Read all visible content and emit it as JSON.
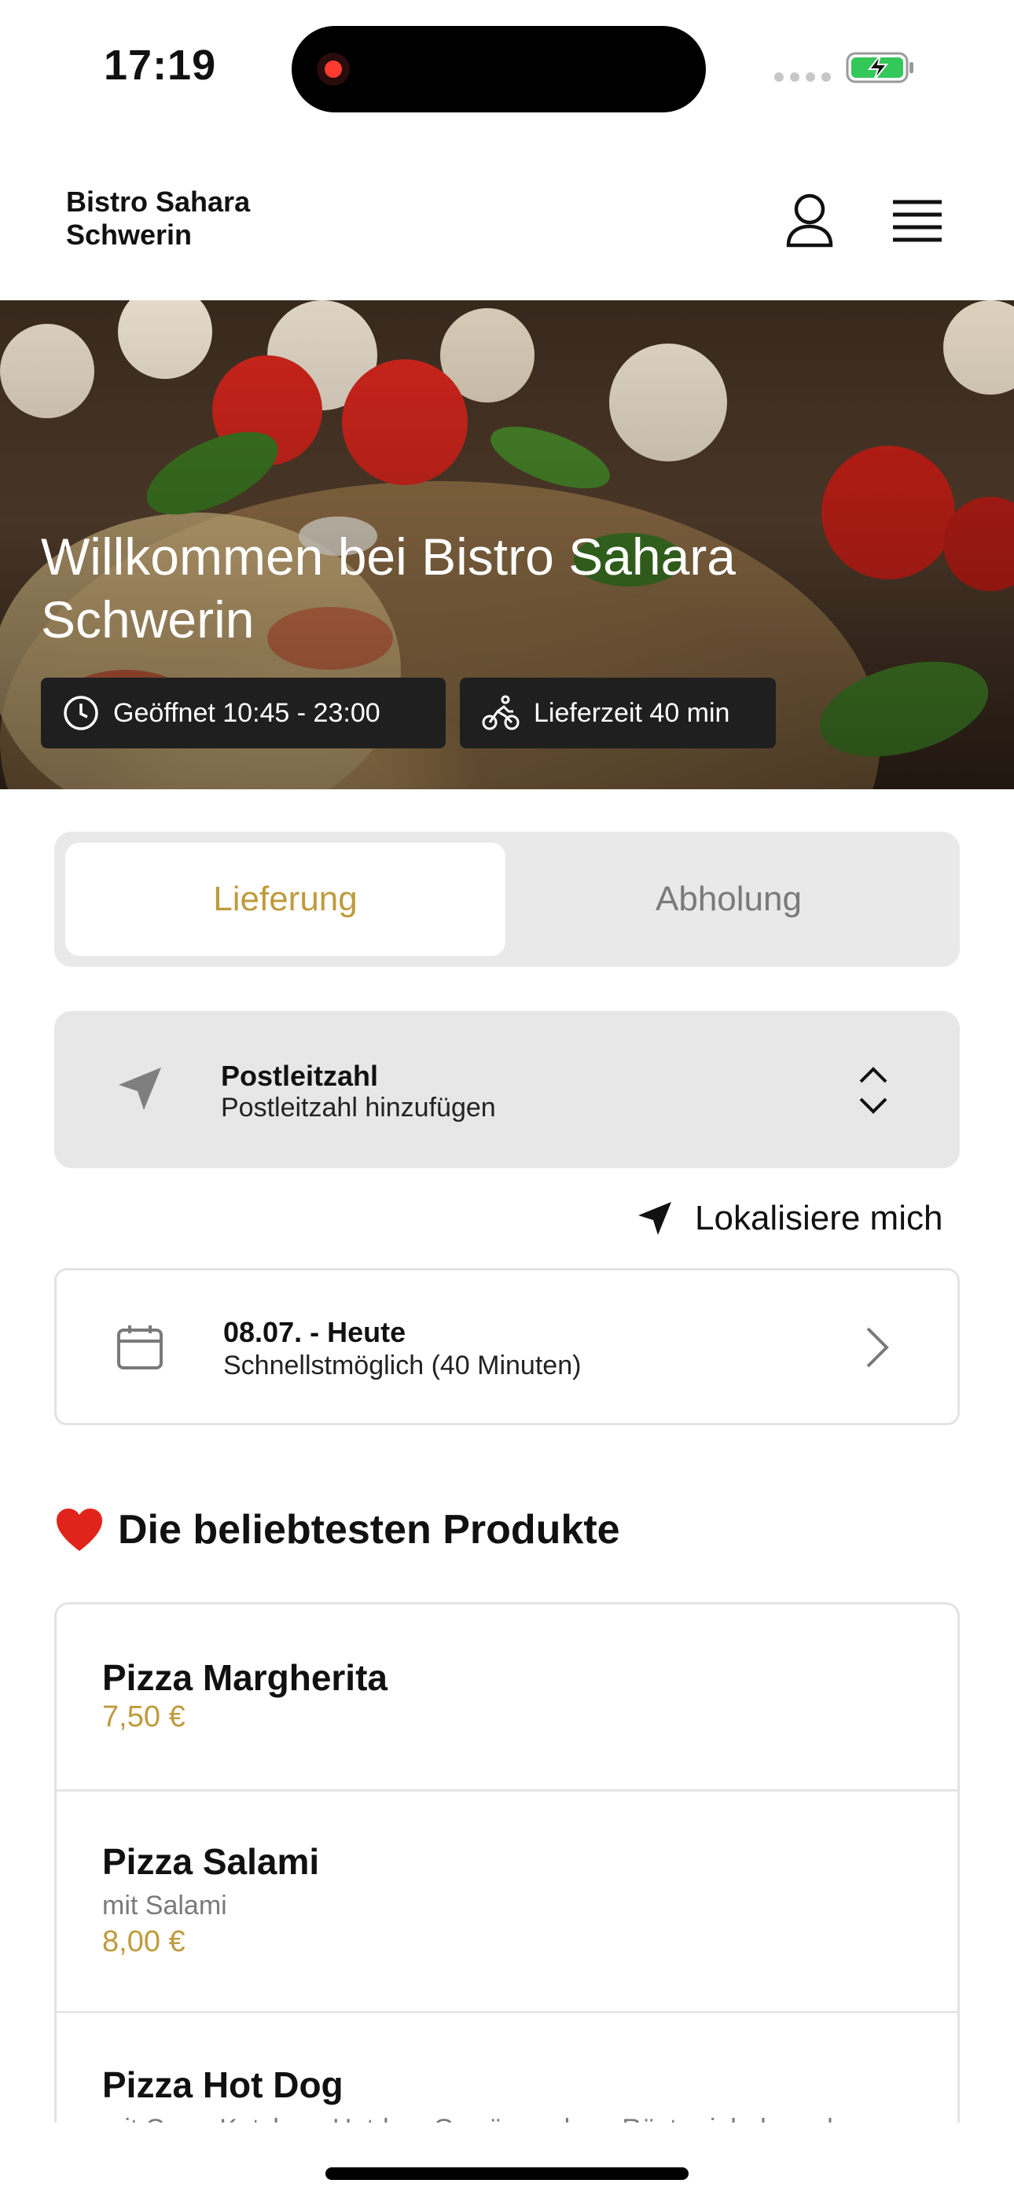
{
  "status_bar": {
    "time": "17:19"
  },
  "header": {
    "brand_line1": "Bistro Sahara",
    "brand_line2": "Schwerin"
  },
  "hero": {
    "title": "Willkommen bei Bistro Sahara Schwerin",
    "hours": "Geöffnet 10:45 - 23:00",
    "delivery_time": "Lieferzeit 40 min"
  },
  "order_mode": {
    "delivery": "Lieferung",
    "pickup": "Abholung",
    "selected": "Lieferung"
  },
  "postcode": {
    "title": "Postleitzahl",
    "placeholder": "Postleitzahl hinzufügen"
  },
  "locate_label": "Lokalisiere mich",
  "schedule": {
    "date": "08.07. - Heute",
    "time": "Schnellstmöglich (40 Minuten)"
  },
  "popular": {
    "heading": "Die beliebtesten Produkte",
    "emoji": "❤️",
    "products": [
      {
        "name": "Pizza Margherita",
        "description": "",
        "price": "7,50 €"
      },
      {
        "name": "Pizza Salami",
        "description": "mit Salami",
        "price": "8,00 €"
      },
      {
        "name": "Pizza Hot Dog",
        "description": "mit Curry-Ketchup, Hotdog, Gewürzgurken, Röstzwiebeln und",
        "price": ""
      }
    ]
  },
  "colors": {
    "accent": "#bf9b3e",
    "badge_bg": "#1f1f1f",
    "card_bg": "#e7e7e7"
  }
}
